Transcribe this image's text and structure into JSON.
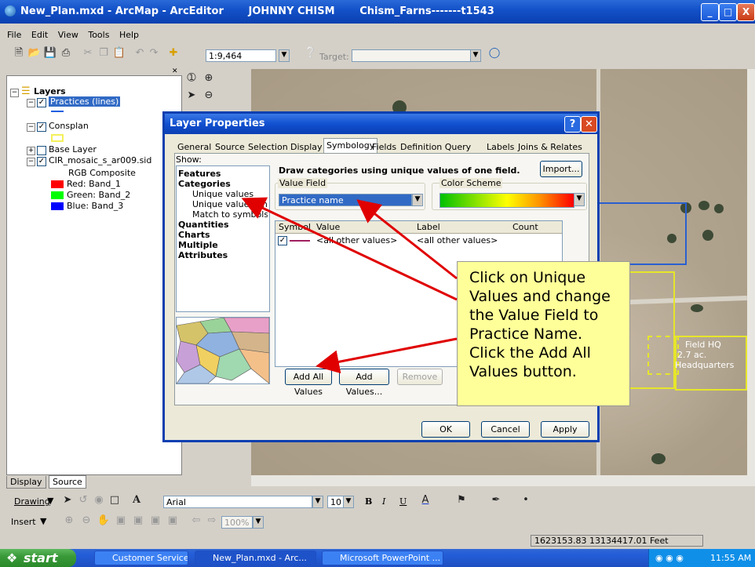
{
  "window": {
    "title": "New_Plan.mxd - ArcMap - ArcEditor       JOHNNY CHISM       Chism_Farns-------t1543",
    "buttons": [
      "_",
      "□",
      "X"
    ]
  },
  "menu": [
    "File",
    "Edit",
    "View",
    "Tools",
    "Help"
  ],
  "standard_toolbar": {
    "scale": "1:9,464",
    "target_label": "Target:",
    "target_value": ""
  },
  "toc": {
    "root": "Layers",
    "layers": [
      {
        "name": "Practices (lines)",
        "checked": true,
        "selected": true
      },
      {
        "name": "Consplan",
        "checked": true
      },
      {
        "name": "Base Layer",
        "checked": false
      },
      {
        "name": "CIR_mosaic_s_ar009.sid",
        "checked": true
      }
    ],
    "raster_legend": {
      "title": "RGB Composite",
      "bands": [
        {
          "label": "Red:  Band_1",
          "color": "#ff0000"
        },
        {
          "label": "Green: Band_2",
          "color": "#00ff00"
        },
        {
          "label": "Blue:  Band_3",
          "color": "#0000ff"
        }
      ]
    },
    "tabs": [
      "Display",
      "Source"
    ]
  },
  "dialog": {
    "title": "Layer Properties",
    "tabs": [
      "General",
      "Source",
      "Selection",
      "Display",
      "Symbology",
      "Fields",
      "Definition Query",
      "Labels",
      "Joins & Relates"
    ],
    "active_tab": "Symbology",
    "show_label": "Show:",
    "show_items": [
      {
        "label": "Features",
        "bold": true
      },
      {
        "label": "Categories",
        "bold": true
      },
      {
        "label": "Unique values",
        "bold": false,
        "indent": true
      },
      {
        "label": "Unique values, many f",
        "bold": false,
        "indent": true
      },
      {
        "label": "Match to symbols in a",
        "bold": false,
        "indent": true
      },
      {
        "label": "Quantities",
        "bold": true
      },
      {
        "label": "Charts",
        "bold": true
      },
      {
        "label": "Multiple Attributes",
        "bold": true
      }
    ],
    "heading": "Draw categories using unique values of one field.",
    "import_button": "Import...",
    "value_field_label": "Value Field",
    "value_field_value": "Practice name",
    "color_scheme_label": "Color Scheme",
    "table_headers": [
      "Symbol",
      "Value",
      "Label",
      "Count"
    ],
    "table_rows": [
      {
        "value": "<all other values>",
        "label": "<all other values>",
        "count": ""
      }
    ],
    "buttons": {
      "add_all": "Add All Values",
      "add": "Add Values...",
      "remove": "Remove",
      "ok": "OK",
      "cancel": "Cancel",
      "apply": "Apply"
    }
  },
  "callout": "Click on Unique\nValues and change\nthe Value Field to\nPractice Name.\nClick the Add All\nValues button.",
  "map_labels": {
    "field_hq": "Field HQ",
    "acres": "2.7 ac.",
    "headquarters": "Headquarters"
  },
  "drawing_toolbar": {
    "drawing_label": "Drawing",
    "font": "Arial",
    "font_size": "10",
    "bold": "B",
    "italic": "I",
    "underline": "U"
  },
  "insert_toolbar": {
    "insert_label": "Insert",
    "zoom": "100%"
  },
  "status": {
    "coordinates": "1623153.83  13134417.01 Feet"
  },
  "taskbar": {
    "start": "start",
    "items": [
      "Customer Service To...",
      "New_Plan.mxd - Arc...",
      "Microsoft PowerPoint ..."
    ],
    "clock": "11:55 AM"
  }
}
